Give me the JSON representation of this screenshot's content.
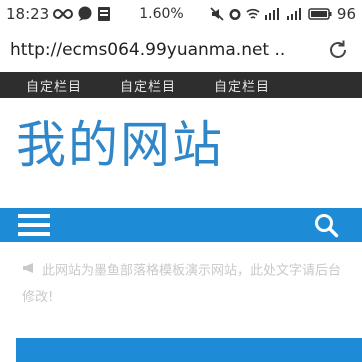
{
  "status": {
    "time": "18:23",
    "data_rate": "1.60%",
    "battery": "96"
  },
  "browser": {
    "url": "http://ecms064.99yuanma.net .."
  },
  "nav": {
    "items": [
      "自定栏目",
      "自定栏目",
      "自定栏目"
    ]
  },
  "site": {
    "title": "我的网站"
  },
  "notice": {
    "text": "此网站为墨鱼部落格模板演示网站，此处文字请后台修改!"
  },
  "colors": {
    "brand_blue": "#1d8bd6",
    "title_blue": "#2f87c9",
    "nav_bg": "#2e2e2e"
  }
}
